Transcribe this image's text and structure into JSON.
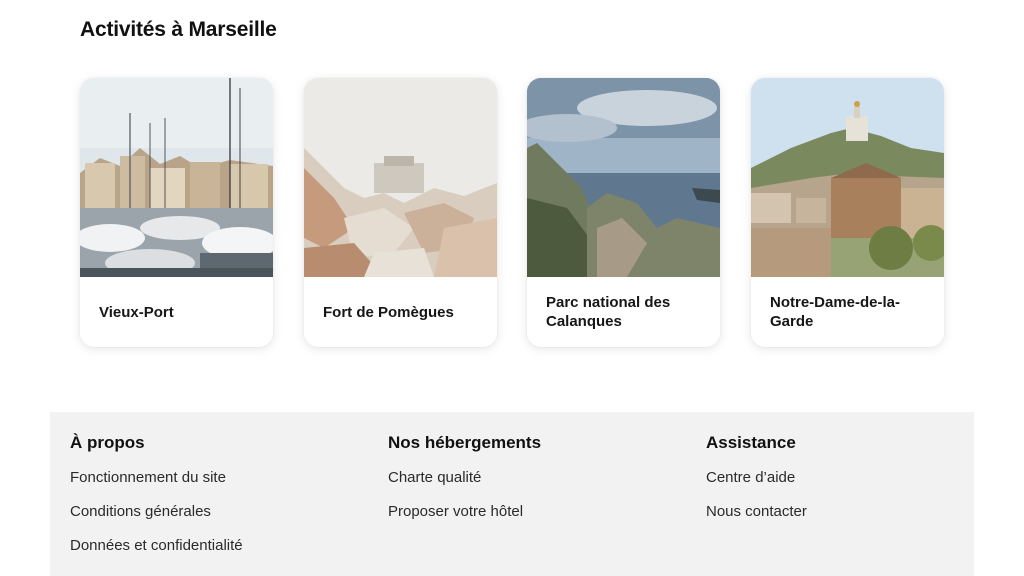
{
  "page": {
    "section_title": "Activités à Marseille"
  },
  "activities": [
    {
      "title": "Vieux-Port",
      "image": "vieux-port-photo"
    },
    {
      "title": "Fort de Pomègues",
      "image": "fort-pomegues-photo"
    },
    {
      "title": "Parc national des Calanques",
      "image": "calanques-photo"
    },
    {
      "title": "Notre-Dame-de-la-Garde",
      "image": "notre-dame-photo"
    }
  ],
  "footer": {
    "columns": [
      {
        "heading": "À propos",
        "links": [
          "Fonctionnement du site",
          "Conditions générales",
          "Données et confidentialité"
        ]
      },
      {
        "heading": "Nos hébergements",
        "links": [
          "Charte qualité",
          "Proposer votre hôtel"
        ]
      },
      {
        "heading": "Assistance",
        "links": [
          "Centre d’aide",
          "Nous contacter"
        ]
      }
    ]
  },
  "colors": {
    "footer_background": "#f2f2f2",
    "text": "#111111"
  }
}
